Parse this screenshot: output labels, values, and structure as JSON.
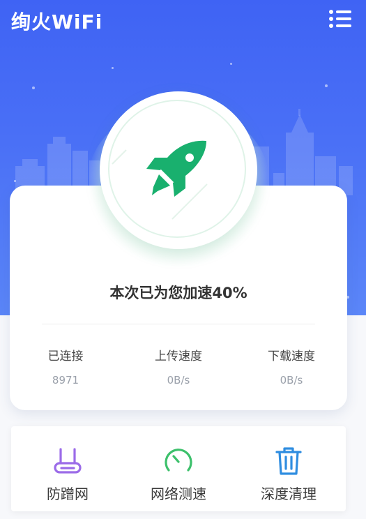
{
  "header": {
    "title": "绚火WiFi",
    "menu_icon": "list-menu-icon"
  },
  "boost": {
    "text": "本次已为您加速40%"
  },
  "stats": [
    {
      "label": "已连接",
      "value": "8971"
    },
    {
      "label": "上传速度",
      "value": "0B/s"
    },
    {
      "label": "下载速度",
      "value": "0B/s"
    }
  ],
  "features": [
    {
      "label": "防蹭网",
      "icon": "router-icon",
      "color": "#9b6be8"
    },
    {
      "label": "网络测速",
      "icon": "speedometer-icon",
      "color": "#3cc06b"
    },
    {
      "label": "深度清理",
      "icon": "trash-icon",
      "color": "#2f8de0"
    }
  ],
  "colors": {
    "primary": "#4465f5",
    "rocket": "#19b06e"
  }
}
